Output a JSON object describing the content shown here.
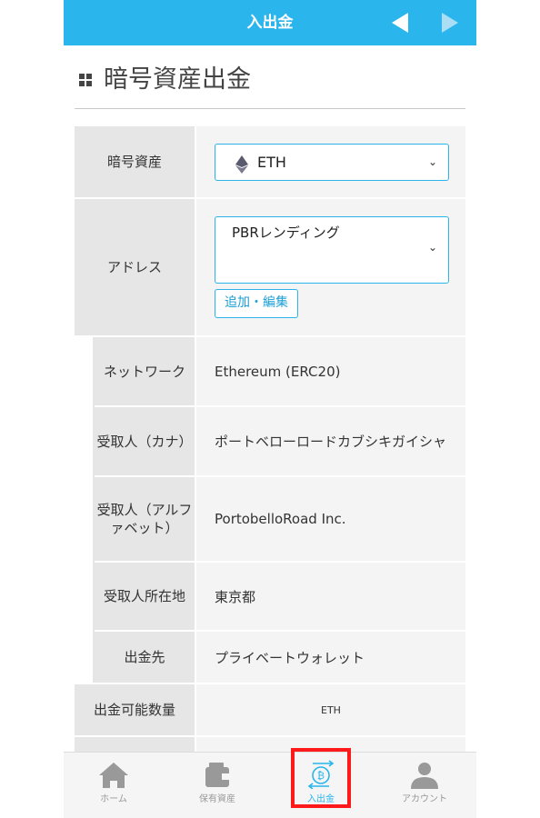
{
  "header": {
    "title": "入出金"
  },
  "page": {
    "title": "暗号資産出金"
  },
  "form": {
    "asset": {
      "label": "暗号資産",
      "value": "ETH"
    },
    "address": {
      "label": "アドレス",
      "value": "PBRレンディング",
      "edit_button": "追加・編集"
    },
    "details": [
      {
        "label": "ネットワーク",
        "value": "Ethereum (ERC20)"
      },
      {
        "label": "受取人（カナ）",
        "value": "ポートベローロードカブシキガイシャ"
      },
      {
        "label": "受取人（アルファベット）",
        "value": "PortobelloRoad Inc."
      },
      {
        "label": "受取人所在地",
        "value": "東京都"
      },
      {
        "label": "出金先",
        "value": "プライベートウォレット"
      }
    ],
    "available": {
      "label": "出金可能数量",
      "value": "ETH"
    }
  },
  "tabbar": {
    "items": [
      {
        "label": "ホーム",
        "icon": "home-icon"
      },
      {
        "label": "保有資産",
        "icon": "wallet-icon"
      },
      {
        "label": "入出金",
        "icon": "bitcoin-transfer-icon",
        "active": true
      },
      {
        "label": "アカウント",
        "icon": "user-icon"
      }
    ]
  },
  "colors": {
    "accent": "#2ab5ec",
    "highlight": "#ff1a1a",
    "label_bg": "#e6e6e6",
    "value_bg": "#f4f4f4"
  }
}
